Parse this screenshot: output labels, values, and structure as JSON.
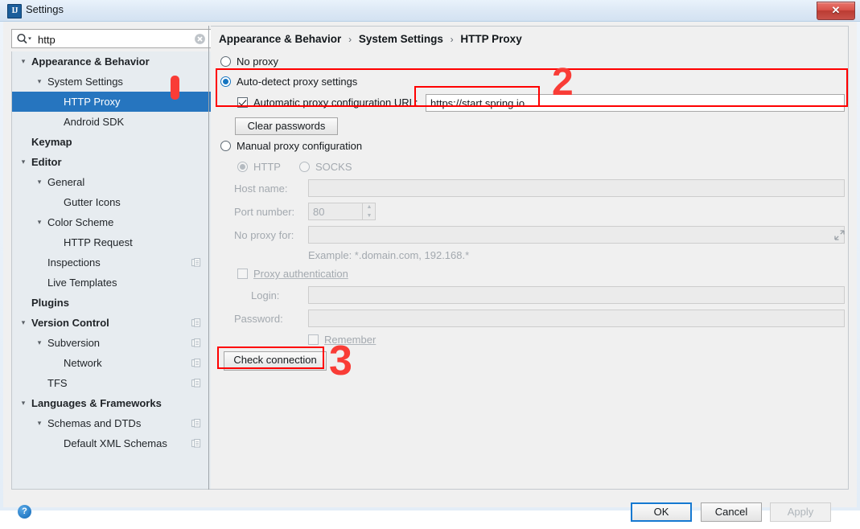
{
  "window": {
    "title": "Settings",
    "app_icon": "intellij-idea-icon",
    "close_label": "✕"
  },
  "search": {
    "value": "http",
    "placeholder": "",
    "icon": "search-icon",
    "clear_icon": "clear-circle-icon"
  },
  "tree": {
    "items": [
      {
        "label": "Appearance & Behavior",
        "level": 0,
        "bold": true,
        "arrow": "▾",
        "selected": false,
        "copy_icon": false
      },
      {
        "label": "System Settings",
        "level": 1,
        "bold": false,
        "arrow": "▾",
        "selected": false,
        "copy_icon": false
      },
      {
        "label": "HTTP Proxy",
        "level": 2,
        "bold": false,
        "arrow": "",
        "selected": true,
        "copy_icon": false
      },
      {
        "label": "Android SDK",
        "level": 2,
        "bold": false,
        "arrow": "",
        "selected": false,
        "copy_icon": false
      },
      {
        "label": "Keymap",
        "level": 0,
        "bold": true,
        "arrow": "",
        "selected": false,
        "copy_icon": false
      },
      {
        "label": "Editor",
        "level": 0,
        "bold": true,
        "arrow": "▾",
        "selected": false,
        "copy_icon": false
      },
      {
        "label": "General",
        "level": 1,
        "bold": false,
        "arrow": "▾",
        "selected": false,
        "copy_icon": false
      },
      {
        "label": "Gutter Icons",
        "level": 2,
        "bold": false,
        "arrow": "",
        "selected": false,
        "copy_icon": false
      },
      {
        "label": "Color Scheme",
        "level": 1,
        "bold": false,
        "arrow": "▾",
        "selected": false,
        "copy_icon": false
      },
      {
        "label": "HTTP Request",
        "level": 2,
        "bold": false,
        "arrow": "",
        "selected": false,
        "copy_icon": false
      },
      {
        "label": "Inspections",
        "level": 1,
        "bold": false,
        "arrow": "",
        "selected": false,
        "copy_icon": true
      },
      {
        "label": "Live Templates",
        "level": 1,
        "bold": false,
        "arrow": "",
        "selected": false,
        "copy_icon": false
      },
      {
        "label": "Plugins",
        "level": 0,
        "bold": true,
        "arrow": "",
        "selected": false,
        "copy_icon": false
      },
      {
        "label": "Version Control",
        "level": 0,
        "bold": true,
        "arrow": "▾",
        "selected": false,
        "copy_icon": true
      },
      {
        "label": "Subversion",
        "level": 1,
        "bold": false,
        "arrow": "▾",
        "selected": false,
        "copy_icon": true
      },
      {
        "label": "Network",
        "level": 2,
        "bold": false,
        "arrow": "",
        "selected": false,
        "copy_icon": true
      },
      {
        "label": "TFS",
        "level": 1,
        "bold": false,
        "arrow": "",
        "selected": false,
        "copy_icon": true
      },
      {
        "label": "Languages & Frameworks",
        "level": 0,
        "bold": true,
        "arrow": "▾",
        "selected": false,
        "copy_icon": false
      },
      {
        "label": "Schemas and DTDs",
        "level": 1,
        "bold": false,
        "arrow": "▾",
        "selected": false,
        "copy_icon": true
      },
      {
        "label": "Default XML Schemas",
        "level": 2,
        "bold": false,
        "arrow": "",
        "selected": false,
        "copy_icon": true
      }
    ]
  },
  "breadcrumb": {
    "part1": "Appearance & Behavior",
    "part2": "System Settings",
    "part3": "HTTP Proxy",
    "separator": "›"
  },
  "proxy": {
    "no_proxy_label": "No proxy",
    "auto_detect_label": "Auto-detect proxy settings",
    "auto_config_url_label": "Automatic proxy configuration URL:",
    "auto_config_url_value": "https://start.spring.io",
    "clear_passwords_label": "Clear passwords",
    "manual_label": "Manual proxy configuration",
    "http_label": "HTTP",
    "socks_label": "SOCKS",
    "host_name_label": "Host name:",
    "host_name_value": "",
    "port_number_label": "Port number:",
    "port_number_value": "80",
    "no_proxy_for_label": "No proxy for:",
    "no_proxy_for_value": "",
    "example_text": "Example: *.domain.com, 192.168.*",
    "proxy_auth_label": "Proxy authentication",
    "login_label": "Login:",
    "login_value": "",
    "password_label": "Password:",
    "password_value": "",
    "remember_label": "Remember",
    "check_connection_label": "Check connection",
    "selected_mode": "auto-detect",
    "selected_protocol": "HTTP",
    "auto_config_url_checked": true,
    "proxy_auth_checked": false,
    "remember_checked": false
  },
  "annotations": {
    "marker1": "1",
    "marker2": "2",
    "marker3": "3",
    "color": "#f93c36"
  },
  "footer": {
    "help_label": "?",
    "ok_label": "OK",
    "cancel_label": "Cancel",
    "apply_label": "Apply"
  }
}
